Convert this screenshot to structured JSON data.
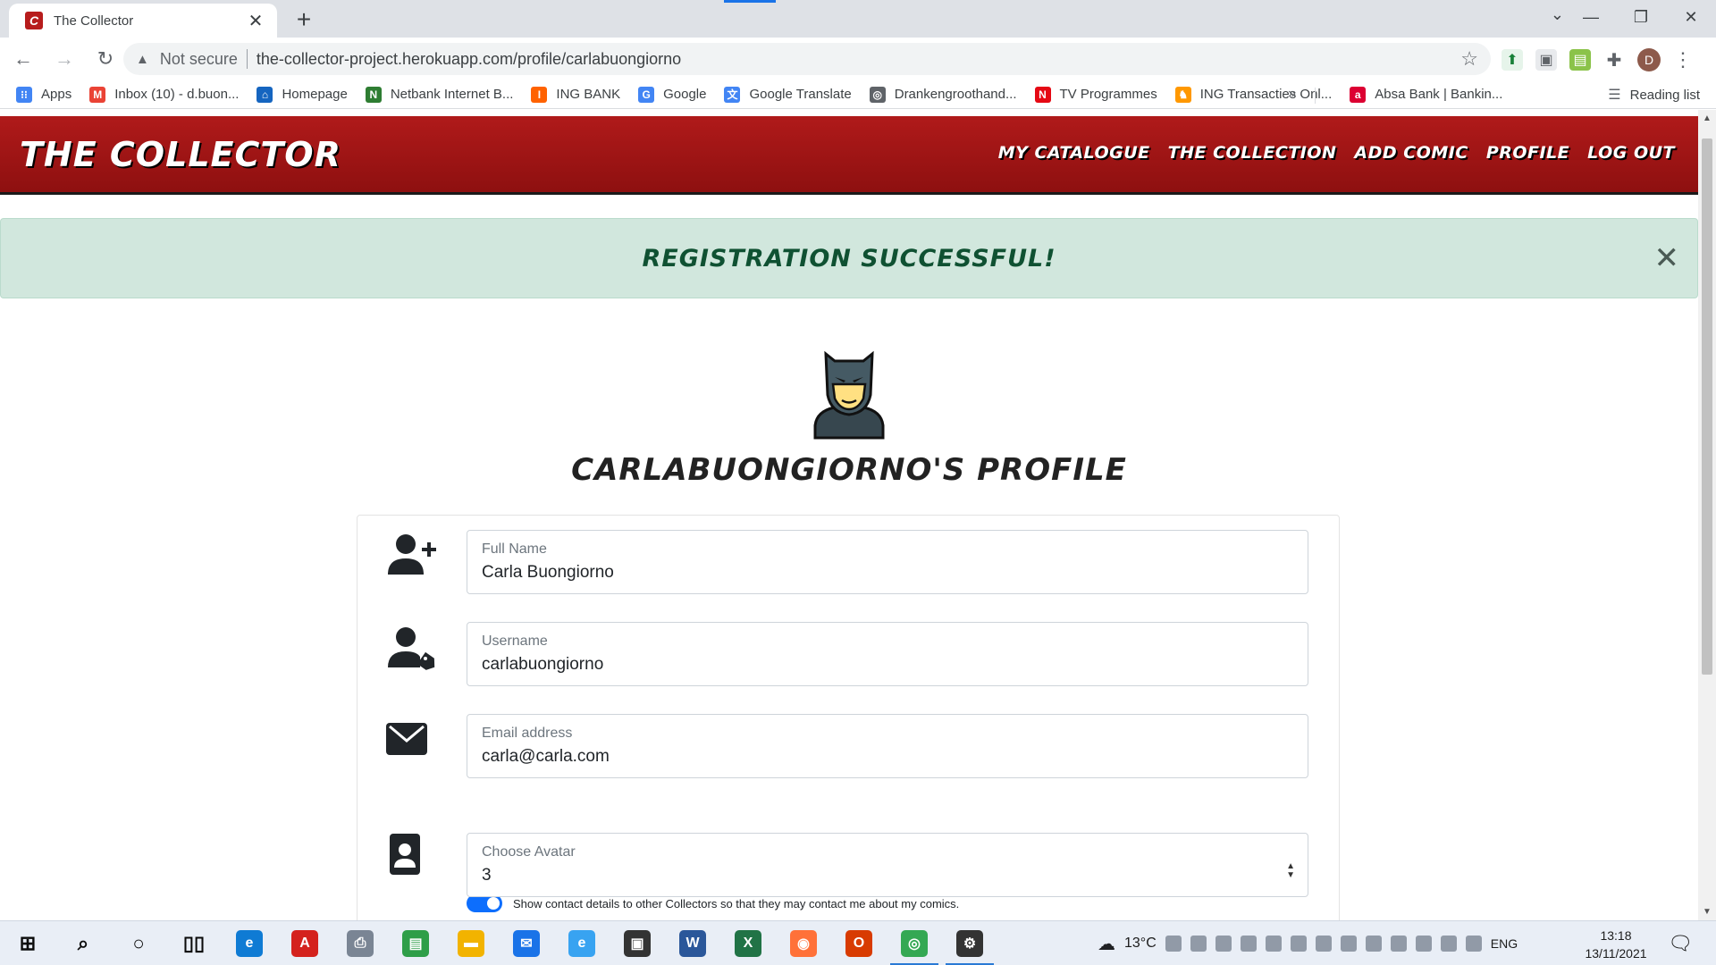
{
  "browser": {
    "tab_title": "The Collector",
    "tab_favicon_letter": "C",
    "security_label": "Not secure",
    "url": "the-collector-project.herokuapp.com/profile/carlabuongiorno",
    "profile_initial": "D",
    "bookmarks": [
      {
        "label": "Apps",
        "icon": "apps-grid-icon",
        "color": "#4285f4",
        "glyph": "⁝⁝"
      },
      {
        "label": "Inbox (10) - d.buon...",
        "icon": "gmail-icon",
        "color": "#ea4335",
        "glyph": "M"
      },
      {
        "label": "Homepage",
        "icon": "homepage-icon",
        "color": "#1565c0",
        "glyph": "⌂"
      },
      {
        "label": "Netbank Internet B...",
        "icon": "netbank-icon",
        "color": "#2e7d32",
        "glyph": "N"
      },
      {
        "label": "ING BANK",
        "icon": "ing-icon",
        "color": "#ff6200",
        "glyph": "I"
      },
      {
        "label": "Google",
        "icon": "google-icon",
        "color": "#4285f4",
        "glyph": "G"
      },
      {
        "label": "Google Translate",
        "icon": "translate-icon",
        "color": "#4285f4",
        "glyph": "文"
      },
      {
        "label": "Drankengroothand...",
        "icon": "globe-icon",
        "color": "#5f6368",
        "glyph": "◎"
      },
      {
        "label": "TV Programmes",
        "icon": "netflix-icon",
        "color": "#e50914",
        "glyph": "N"
      },
      {
        "label": "ING Transacties Onl...",
        "icon": "ing-lion-icon",
        "color": "#ff9800",
        "glyph": "♞"
      },
      {
        "label": "Absa Bank | Bankin...",
        "icon": "absa-icon",
        "color": "#dc0032",
        "glyph": "a"
      }
    ],
    "bookmarks_overflow": "»",
    "reading_list": "Reading list"
  },
  "site": {
    "brand": "The Collector",
    "nav": [
      "My Catalogue",
      "The Collection",
      "Add Comic",
      "Profile",
      "Log Out"
    ],
    "flash_message": "Registration Successful!",
    "profile_heading": "carlabuongiorno's Profile",
    "form": {
      "full_name_label": "Full Name",
      "full_name_value": "Carla Buongiorno",
      "username_label": "Username",
      "username_value": "carlabuongiorno",
      "email_label": "Email address",
      "email_value": "carla@carla.com",
      "contact_toggle_label": "Show contact details to other Collectors so that they may contact me about my comics.",
      "contact_toggle_on": true,
      "avatar_label": "Choose Avatar",
      "avatar_value": "3"
    }
  },
  "taskbar": {
    "apps": [
      {
        "name": "start-icon",
        "glyph": "⊞",
        "color": "#0a0a0a"
      },
      {
        "name": "search-icon",
        "glyph": "⌕",
        "color": "#0a0a0a"
      },
      {
        "name": "cortana-icon",
        "glyph": "○",
        "color": "#0a0a0a"
      },
      {
        "name": "task-view-icon",
        "glyph": "▯▯",
        "color": "#0a0a0a"
      },
      {
        "name": "edge-icon",
        "glyph": "e",
        "color": "#0f7bd4"
      },
      {
        "name": "acrobat-icon",
        "glyph": "A",
        "color": "#d4221d"
      },
      {
        "name": "printer-icon",
        "glyph": "⎙",
        "color": "#7a8594"
      },
      {
        "name": "notes-icon",
        "glyph": "▤",
        "color": "#2e9e48"
      },
      {
        "name": "file-explorer-icon",
        "glyph": "▬",
        "color": "#f2b300"
      },
      {
        "name": "mail-icon",
        "glyph": "✉",
        "color": "#1a73e8"
      },
      {
        "name": "ie-icon",
        "glyph": "e",
        "color": "#38a3f1"
      },
      {
        "name": "store-icon",
        "glyph": "▣",
        "color": "#333333"
      },
      {
        "name": "word-icon",
        "glyph": "W",
        "color": "#2b579a"
      },
      {
        "name": "excel-icon",
        "glyph": "X",
        "color": "#217346"
      },
      {
        "name": "firefox-icon",
        "glyph": "◉",
        "color": "#ff7139"
      },
      {
        "name": "office-icon",
        "glyph": "O",
        "color": "#d83b01"
      },
      {
        "name": "chrome-icon",
        "glyph": "◎",
        "color": "#34a853"
      },
      {
        "name": "settings-icon",
        "glyph": "⚙",
        "color": "#333333"
      }
    ],
    "temperature": "13°C",
    "language": "ENG",
    "time": "13:18",
    "date": "13/11/2021"
  }
}
